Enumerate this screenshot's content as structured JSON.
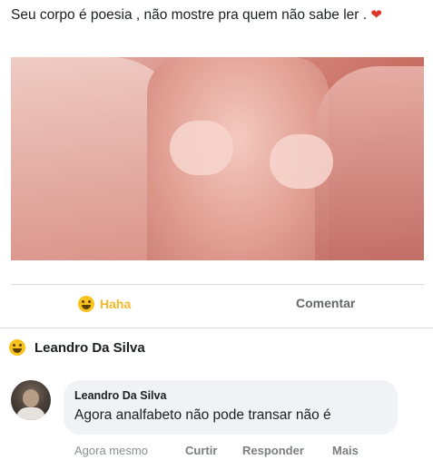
{
  "post": {
    "text": "Seu corpo é poesia , não mostre pra quem não sabe ler .",
    "emoji": "heart"
  },
  "actions": {
    "reaction_label": "Haha",
    "comment_label": "Comentar"
  },
  "reaction_header": {
    "name": "Leandro Da Silva",
    "emoji": "laughing-face"
  },
  "comment": {
    "author": "Leandro Da Silva",
    "text": "Agora analfabeto não pode transar não é",
    "timestamp": "Agora mesmo",
    "like_label": "Curtir",
    "reply_label": "Responder",
    "more_label": "Mais"
  },
  "colors": {
    "haha_text": "#f7b928",
    "link_gray": "#65676b",
    "bubble_bg": "#f0f2f5"
  }
}
